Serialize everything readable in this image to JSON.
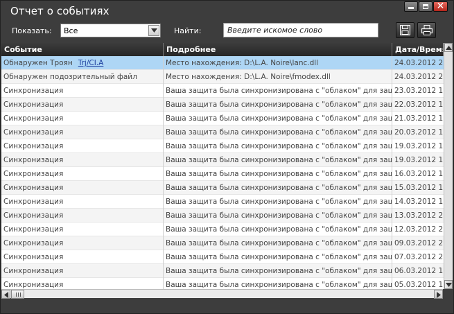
{
  "window": {
    "title": "Отчет о событиях"
  },
  "toolbar": {
    "show_label": "Показать:",
    "show_value": "Все",
    "find_label": "Найти:",
    "search_placeholder": "Введите искомое слово"
  },
  "table": {
    "columns": [
      "Событие",
      "Подробнее",
      "Дата/Время"
    ],
    "rows": [
      {
        "event": "Обнаружен Троян",
        "link": "Trj/CI.A",
        "details": "Место нахождения: D:\\L.A. Noire\\lanc.dll",
        "date": "24.03.2012 2",
        "selected": true
      },
      {
        "event": "Обнаружен подозрительный файл",
        "link": "",
        "details": "Место нахождения: D:\\L.A. Noire\\fmodex.dll",
        "date": "24.03.2012 2",
        "selected": false
      },
      {
        "event": "Синхронизация",
        "link": "",
        "details": "Ваша защита была синхронизирована с \"облаком\" для защит...",
        "date": "23.03.2012 1",
        "selected": false
      },
      {
        "event": "Синхронизация",
        "link": "",
        "details": "Ваша защита была синхронизирована с \"облаком\" для защит...",
        "date": "22.03.2012 1",
        "selected": false
      },
      {
        "event": "Синхронизация",
        "link": "",
        "details": "Ваша защита была синхронизирована с \"облаком\" для защит...",
        "date": "21.03.2012 1",
        "selected": false
      },
      {
        "event": "Синхронизация",
        "link": "",
        "details": "Ваша защита была синхронизирована с \"облаком\" для защит...",
        "date": "20.03.2012 1",
        "selected": false
      },
      {
        "event": "Синхронизация",
        "link": "",
        "details": "Ваша защита была синхронизирована с \"облаком\" для защит...",
        "date": "19.03.2012 1",
        "selected": false
      },
      {
        "event": "Синхронизация",
        "link": "",
        "details": "Ваша защита была синхронизирована с \"облаком\" для защит...",
        "date": "19.03.2012 1",
        "selected": false
      },
      {
        "event": "Синхронизация",
        "link": "",
        "details": "Ваша защита была синхронизирована с \"облаком\" для защит...",
        "date": "16.03.2012 1",
        "selected": false
      },
      {
        "event": "Синхронизация",
        "link": "",
        "details": "Ваша защита была синхронизирована с \"облаком\" для защит...",
        "date": "15.03.2012 1",
        "selected": false
      },
      {
        "event": "Синхронизация",
        "link": "",
        "details": "Ваша защита была синхронизирована с \"облаком\" для защит...",
        "date": "14.03.2012 1",
        "selected": false
      },
      {
        "event": "Синхронизация",
        "link": "",
        "details": "Ваша защита была синхронизирована с \"облаком\" для защит...",
        "date": "13.03.2012 2",
        "selected": false
      },
      {
        "event": "Синхронизация",
        "link": "",
        "details": "Ваша защита была синхронизирована с \"облаком\" для защит...",
        "date": "12.03.2012 2",
        "selected": false
      },
      {
        "event": "Синхронизация",
        "link": "",
        "details": "Ваша защита была синхронизирована с \"облаком\" для защит...",
        "date": "09.03.2012 2",
        "selected": false
      },
      {
        "event": "Синхронизация",
        "link": "",
        "details": "Ваша защита была синхронизирована с \"облаком\" для защит...",
        "date": "07.03.2012 2",
        "selected": false
      },
      {
        "event": "Синхронизация",
        "link": "",
        "details": "Ваша защита была синхронизирована с \"облаком\" для защит...",
        "date": "06.03.2012 1",
        "selected": false
      },
      {
        "event": "Синхронизация",
        "link": "",
        "details": "Ваша защита была синхронизирована с \"облаком\" для защит...",
        "date": "05.03.2012 1",
        "selected": false
      }
    ]
  },
  "icons": {
    "minimize": "minimize-icon",
    "maximize": "maximize-icon",
    "close": "close-icon",
    "save": "floppy-disk-icon",
    "print": "printer-icon",
    "dropdown": "chevron-down-icon"
  },
  "colors": {
    "window_bg": "#3d3d3d",
    "selected_row": "#aed6f5",
    "link": "#1d3f9e",
    "close_button": "#c9382b"
  }
}
